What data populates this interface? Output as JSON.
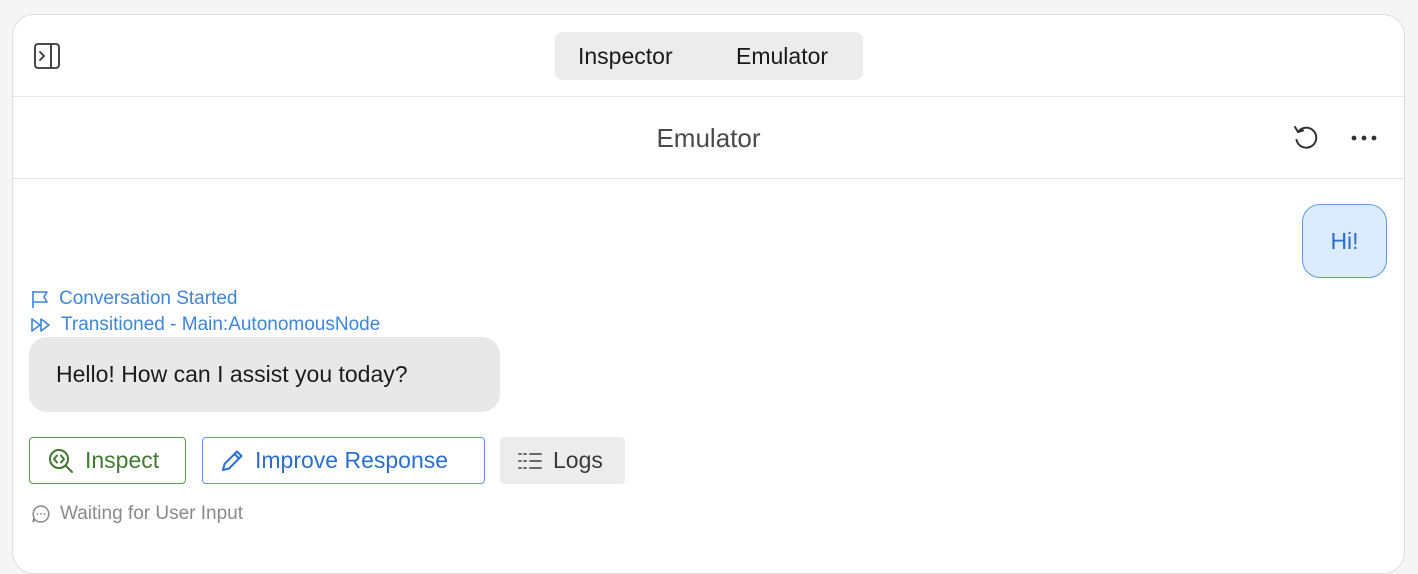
{
  "tabs": [
    {
      "label": "Inspector"
    },
    {
      "label": "Emulator"
    }
  ],
  "header": {
    "title": "Emulator"
  },
  "messages": {
    "user": "Hi!",
    "bot": "Hello! How can I assist you today?"
  },
  "events": [
    {
      "label": "Conversation Started",
      "icon": "flag-icon"
    },
    {
      "label": "Transitioned - Main:AutonomousNode",
      "icon": "fast-forward-icon"
    }
  ],
  "actions": {
    "inspect": "Inspect",
    "improve": "Improve Response",
    "logs": "Logs"
  },
  "status": {
    "label": "Waiting for User Input"
  },
  "colors": {
    "accent_blue": "#2a6fd0",
    "inspect_green": "#3f7a33",
    "user_bubble_bg": "#dcebfd",
    "bot_bubble_bg": "#e8e8e8"
  }
}
